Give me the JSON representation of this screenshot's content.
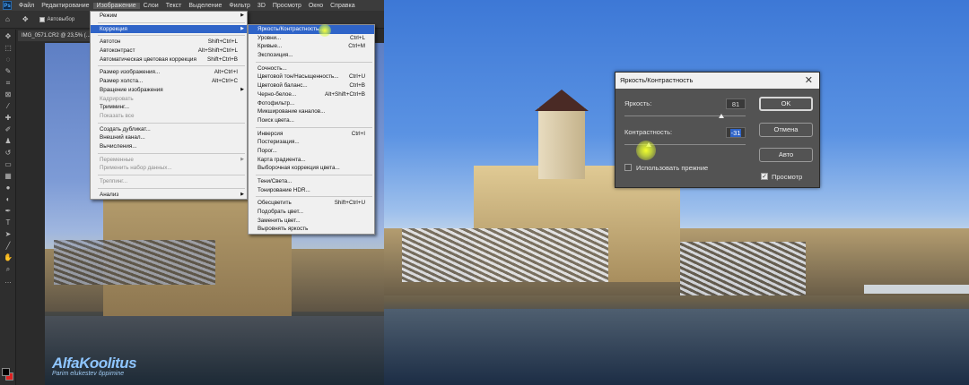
{
  "menubar": {
    "items": [
      "Файл",
      "Редактирование",
      "Изображение",
      "Слои",
      "Текст",
      "Выделение",
      "Фильтр",
      "3D",
      "Просмотр",
      "Окно",
      "Справка"
    ],
    "active_index": 2
  },
  "optionsbar": {
    "auto_select": "Автовыбор"
  },
  "document": {
    "tab": "IMG_0571.CR2 @ 23,5% (..."
  },
  "image_menu": {
    "items": [
      {
        "label": "Режим",
        "submenu": true
      },
      {
        "sep": true
      },
      {
        "label": "Коррекция",
        "submenu": true,
        "highlight": true
      },
      {
        "sep": true
      },
      {
        "label": "Автотон",
        "shortcut": "Shift+Ctrl+L"
      },
      {
        "label": "Автоконтраст",
        "shortcut": "Alt+Shift+Ctrl+L"
      },
      {
        "label": "Автоматическая цветовая коррекция",
        "shortcut": "Shift+Ctrl+B"
      },
      {
        "sep": true
      },
      {
        "label": "Размер изображения...",
        "shortcut": "Alt+Ctrl+I"
      },
      {
        "label": "Размер холста...",
        "shortcut": "Alt+Ctrl+C"
      },
      {
        "label": "Вращение изображения",
        "submenu": true
      },
      {
        "label": "Кадрировать",
        "disabled": true
      },
      {
        "label": "Тримминг..."
      },
      {
        "label": "Показать все",
        "disabled": true
      },
      {
        "sep": true
      },
      {
        "label": "Создать дубликат..."
      },
      {
        "label": "Внешний канал..."
      },
      {
        "label": "Вычисления..."
      },
      {
        "sep": true
      },
      {
        "label": "Переменные",
        "submenu": true,
        "disabled": true
      },
      {
        "label": "Применить набор данных...",
        "disabled": true
      },
      {
        "sep": true
      },
      {
        "label": "Треппинг...",
        "disabled": true
      },
      {
        "sep": true
      },
      {
        "label": "Анализ",
        "submenu": true
      }
    ]
  },
  "adjust_menu": {
    "items": [
      {
        "label": "Яркость/Контрастность...",
        "highlight": true
      },
      {
        "label": "Уровни...",
        "shortcut": "Ctrl+L"
      },
      {
        "label": "Кривые...",
        "shortcut": "Ctrl+M"
      },
      {
        "label": "Экспозиция..."
      },
      {
        "sep": true
      },
      {
        "label": "Сочность..."
      },
      {
        "label": "Цветовой тон/Насыщенность...",
        "shortcut": "Ctrl+U"
      },
      {
        "label": "Цветовой баланс...",
        "shortcut": "Ctrl+B"
      },
      {
        "label": "Черно-белое...",
        "shortcut": "Alt+Shift+Ctrl+B"
      },
      {
        "label": "Фотофильтр..."
      },
      {
        "label": "Микширование каналов..."
      },
      {
        "label": "Поиск цвета..."
      },
      {
        "sep": true
      },
      {
        "label": "Инверсия",
        "shortcut": "Ctrl+I"
      },
      {
        "label": "Постеризация..."
      },
      {
        "label": "Порог..."
      },
      {
        "label": "Карта градиента..."
      },
      {
        "label": "Выборочная коррекция цвета..."
      },
      {
        "sep": true
      },
      {
        "label": "Тени/Света..."
      },
      {
        "label": "Тонирование HDR..."
      },
      {
        "sep": true
      },
      {
        "label": "Обесцветить",
        "shortcut": "Shift+Ctrl+U"
      },
      {
        "label": "Подобрать цвет..."
      },
      {
        "label": "Заменить цвет..."
      },
      {
        "label": "Выровнять яркость"
      }
    ]
  },
  "dialog": {
    "title": "Яркость/Контрастность",
    "close": "✕",
    "brightness_label": "Яркость:",
    "brightness_value": "81",
    "brightness_level": 0.8,
    "contrast_label": "Контрастность:",
    "contrast_value": "-31",
    "contrast_level": 0.2,
    "legacy_label": "Использовать прежние",
    "legacy_checked": false,
    "preview_label": "Просмотр",
    "preview_checked": true,
    "ok": "OK",
    "cancel": "Отмена",
    "auto": "Авто"
  },
  "watermark": {
    "brand": "AlfaKoolitus",
    "tagline": "Parim elukestev õppimine"
  },
  "colors": {
    "highlight": "#2f64c8",
    "dialog_bg": "#535353",
    "fg_swatch": "#000000",
    "bg_swatch": "#d22222"
  }
}
